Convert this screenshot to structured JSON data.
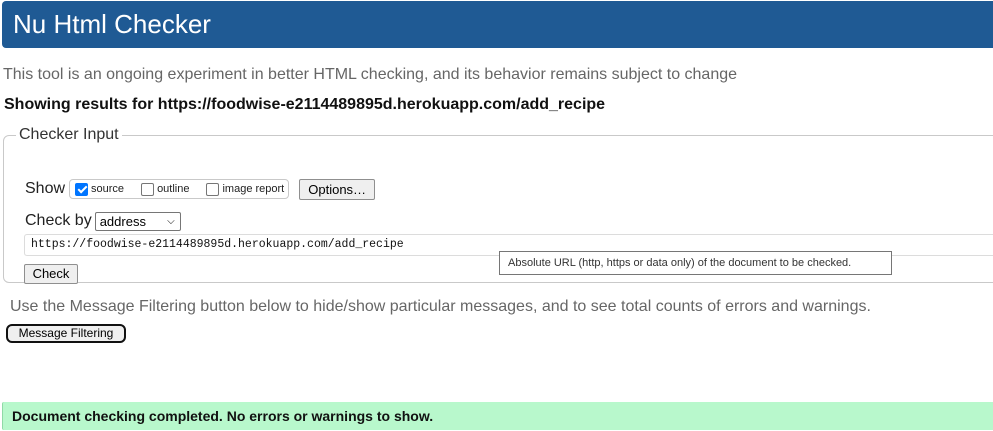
{
  "header": {
    "title": "Nu Html Checker"
  },
  "subtitle": "This tool is an ongoing experiment in better HTML checking, and its behavior remains subject to change",
  "results_heading": "Showing results for https://foodwise-e2114489895d.herokuapp.com/add_recipe",
  "checker_input": {
    "legend": "Checker Input",
    "show_label": "Show",
    "show_options": [
      {
        "label": "source",
        "checked": true
      },
      {
        "label": "outline",
        "checked": false
      },
      {
        "label": "image report",
        "checked": false
      }
    ],
    "options_button": "Options…",
    "check_by_label": "Check by",
    "check_by_value": "address",
    "url_value": "https://foodwise-e2114489895d.herokuapp.com/add_recipe",
    "check_button": "Check"
  },
  "tooltip": "Absolute URL (http, https or data only) of the document to be checked.",
  "filter_help": "Use the Message Filtering button below to hide/show particular messages, and to see total counts of errors and warnings.",
  "filter_button": "Message Filtering",
  "status_message": "Document checking completed. No errors or warnings to show.",
  "colors": {
    "header_bg": "#1f5a94",
    "success_bg": "#b8f8cc",
    "checkbox_checked": "#0075ff"
  }
}
